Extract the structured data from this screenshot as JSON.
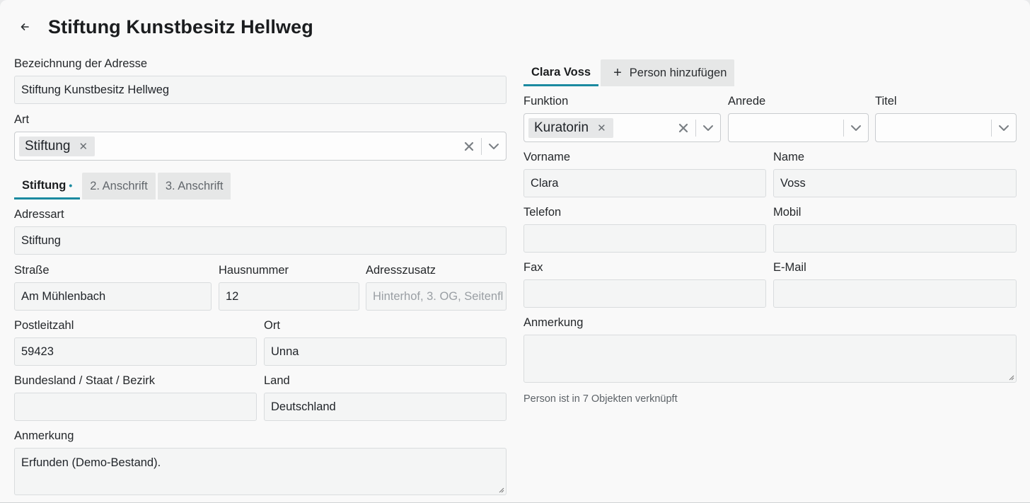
{
  "page": {
    "title": "Stiftung Kunstbesitz Hellweg"
  },
  "left": {
    "bezeichnung": {
      "label": "Bezeichnung der Adresse",
      "value": "Stiftung Kunstbesitz Hellweg"
    },
    "art": {
      "label": "Art",
      "chip": "Stiftung"
    },
    "tabs": [
      {
        "label": "Stiftung",
        "marker": "•"
      },
      {
        "label": "2. Anschrift"
      },
      {
        "label": "3. Anschrift"
      }
    ],
    "adressart": {
      "label": "Adressart",
      "value": "Stiftung"
    },
    "strasse": {
      "label": "Straße",
      "value": "Am Mühlenbach"
    },
    "hausnummer": {
      "label": "Hausnummer",
      "value": "12"
    },
    "adresszusatz": {
      "label": "Adresszusatz",
      "placeholder": "Hinterhof, 3. OG, Seitenfl"
    },
    "plz": {
      "label": "Postleitzahl",
      "value": "59423"
    },
    "ort": {
      "label": "Ort",
      "value": "Unna"
    },
    "bundesland": {
      "label": "Bundesland / Staat / Bezirk",
      "value": ""
    },
    "land": {
      "label": "Land",
      "value": "Deutschland"
    },
    "anmerkung": {
      "label": "Anmerkung",
      "value": "Erfunden (Demo-Bestand)."
    }
  },
  "right": {
    "tabs": [
      {
        "label": "Clara Voss"
      },
      {
        "label": "Person hinzufügen",
        "icon": "plus-icon"
      }
    ],
    "funktion": {
      "label": "Funktion",
      "chip": "Kuratorin"
    },
    "anrede": {
      "label": "Anrede",
      "value": ""
    },
    "titel": {
      "label": "Titel",
      "value": ""
    },
    "vorname": {
      "label": "Vorname",
      "value": "Clara"
    },
    "name": {
      "label": "Name",
      "value": "Voss"
    },
    "telefon": {
      "label": "Telefon",
      "value": ""
    },
    "mobil": {
      "label": "Mobil",
      "value": ""
    },
    "fax": {
      "label": "Fax",
      "value": ""
    },
    "email": {
      "label": "E-Mail",
      "value": ""
    },
    "anmerkung": {
      "label": "Anmerkung",
      "value": ""
    },
    "info": "Person ist in 7 Objekten verknüpft"
  },
  "colors": {
    "accent": "#1b8aa0"
  }
}
